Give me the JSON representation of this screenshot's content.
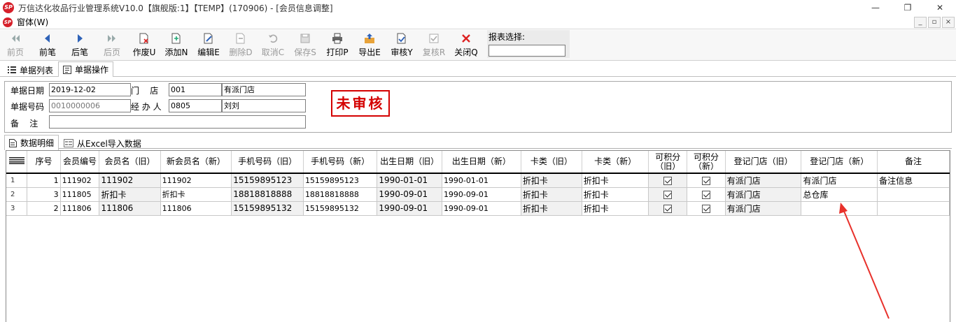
{
  "window": {
    "title": "万信达化妆品行业管理系统V10.0【旗舰版:1】【TEMP】(170906) - [会员信息调整]",
    "minimize": "—",
    "restore": "❐",
    "close": "✕"
  },
  "menu": {
    "label": "窗体(W)"
  },
  "toolbar": {
    "buttons": [
      {
        "name": "prev-page-button",
        "icon": "double-left-arrow-icon",
        "label": "前页",
        "enabled": false
      },
      {
        "name": "prev-record-button",
        "icon": "left-arrow-icon",
        "label": "前笔",
        "enabled": true
      },
      {
        "name": "next-record-button",
        "icon": "right-arrow-icon",
        "label": "后笔",
        "enabled": true
      },
      {
        "name": "next-page-button",
        "icon": "double-right-arrow-icon",
        "label": "后页",
        "enabled": false
      },
      {
        "name": "void-button",
        "icon": "void-document-icon",
        "label": "作废U",
        "enabled": true
      },
      {
        "name": "add-button",
        "icon": "add-document-icon",
        "label": "添加N",
        "enabled": true
      },
      {
        "name": "edit-button",
        "icon": "edit-document-icon",
        "label": "编辑E",
        "enabled": true
      },
      {
        "name": "delete-button",
        "icon": "delete-document-icon",
        "label": "删除D",
        "enabled": false
      },
      {
        "name": "cancel-button",
        "icon": "undo-icon",
        "label": "取消C",
        "enabled": false
      },
      {
        "name": "save-button",
        "icon": "save-icon",
        "label": "保存S",
        "enabled": false
      },
      {
        "name": "print-button",
        "icon": "printer-icon",
        "label": "打印P",
        "enabled": true
      },
      {
        "name": "export-button",
        "icon": "export-icon",
        "label": "导出E",
        "enabled": true
      },
      {
        "name": "approve-button",
        "icon": "approve-icon",
        "label": "审核Y",
        "enabled": true
      },
      {
        "name": "review-button",
        "icon": "review-icon",
        "label": "复核R",
        "enabled": false
      },
      {
        "name": "close-button",
        "icon": "close-x-icon",
        "label": "关闭Q",
        "enabled": true
      }
    ],
    "report_select_label": "报表选择:",
    "report_select_value": ""
  },
  "top_tabs": [
    {
      "label": "单据列表",
      "icon": "list-icon",
      "active": false
    },
    {
      "label": "单据操作",
      "icon": "form-icon",
      "active": true
    }
  ],
  "header": {
    "date_label": "单据日期",
    "date_value": "2019-12-02",
    "store_label": "门    店",
    "store_code": "001",
    "store_name": "有派门店",
    "doc_no_label": "单据号码",
    "doc_no_value": "0010000006",
    "handler_label": "经 办 人",
    "handler_code": "0805",
    "handler_name": "刘刘",
    "remark_label": "备    注",
    "remark_value": "",
    "status_stamp": "未审核"
  },
  "detail_tabs": [
    {
      "label": "数据明细",
      "icon": "document-icon",
      "active": true
    },
    {
      "label": "从Excel导入数据",
      "icon": "excel-icon",
      "active": false
    }
  ],
  "grid": {
    "columns": [
      "序号",
      "会员编号",
      "会员名（旧）",
      "新会员名（新）",
      "手机号码（旧）",
      "手机号码（新）",
      "出生日期（旧）",
      "出生日期（新）",
      "卡类（旧）",
      "卡类（新）",
      "可积分（旧）",
      "可积分（新）",
      "登记门店（旧）",
      "登记门店（新）",
      "备注"
    ],
    "rows": [
      {
        "rownum": "1",
        "seq": "1",
        "member_no": "111902",
        "name_old": "111902",
        "name_new": "111902",
        "phone_old": "15159895123",
        "phone_new": "15159895123",
        "birth_old": "1990-01-01",
        "birth_new": "1990-01-01",
        "card_old": "折扣卡",
        "card_new": "折扣卡",
        "points_old": true,
        "points_new": true,
        "store_old": "有派门店",
        "store_new": "有派门店",
        "remark": "备注信息"
      },
      {
        "rownum": "2",
        "seq": "3",
        "member_no": "111805",
        "name_old": "折扣卡",
        "name_new": "折扣卡",
        "phone_old": "18818818888",
        "phone_new": "18818818888",
        "birth_old": "1990-09-01",
        "birth_new": "1990-09-01",
        "card_old": "折扣卡",
        "card_new": "折扣卡",
        "points_old": true,
        "points_new": true,
        "store_old": "有派门店",
        "store_new": "总仓库",
        "remark": ""
      },
      {
        "rownum": "3",
        "seq": "2",
        "member_no": "111806",
        "name_old": "111806",
        "name_new": "111806",
        "phone_old": "15159895132",
        "phone_new": "15159895132",
        "birth_old": "1990-09-01",
        "birth_new": "1990-09-01",
        "card_old": "折扣卡",
        "card_new": "折扣卡",
        "points_old": true,
        "points_new": true,
        "store_old": "有派门店",
        "store_new": "",
        "remark": ""
      }
    ]
  },
  "colors": {
    "stamp_red": "#d40000",
    "annotation_red": "#e8312b",
    "logo_red": "#d6202a",
    "toolbar_blue": "#2f63b8"
  }
}
